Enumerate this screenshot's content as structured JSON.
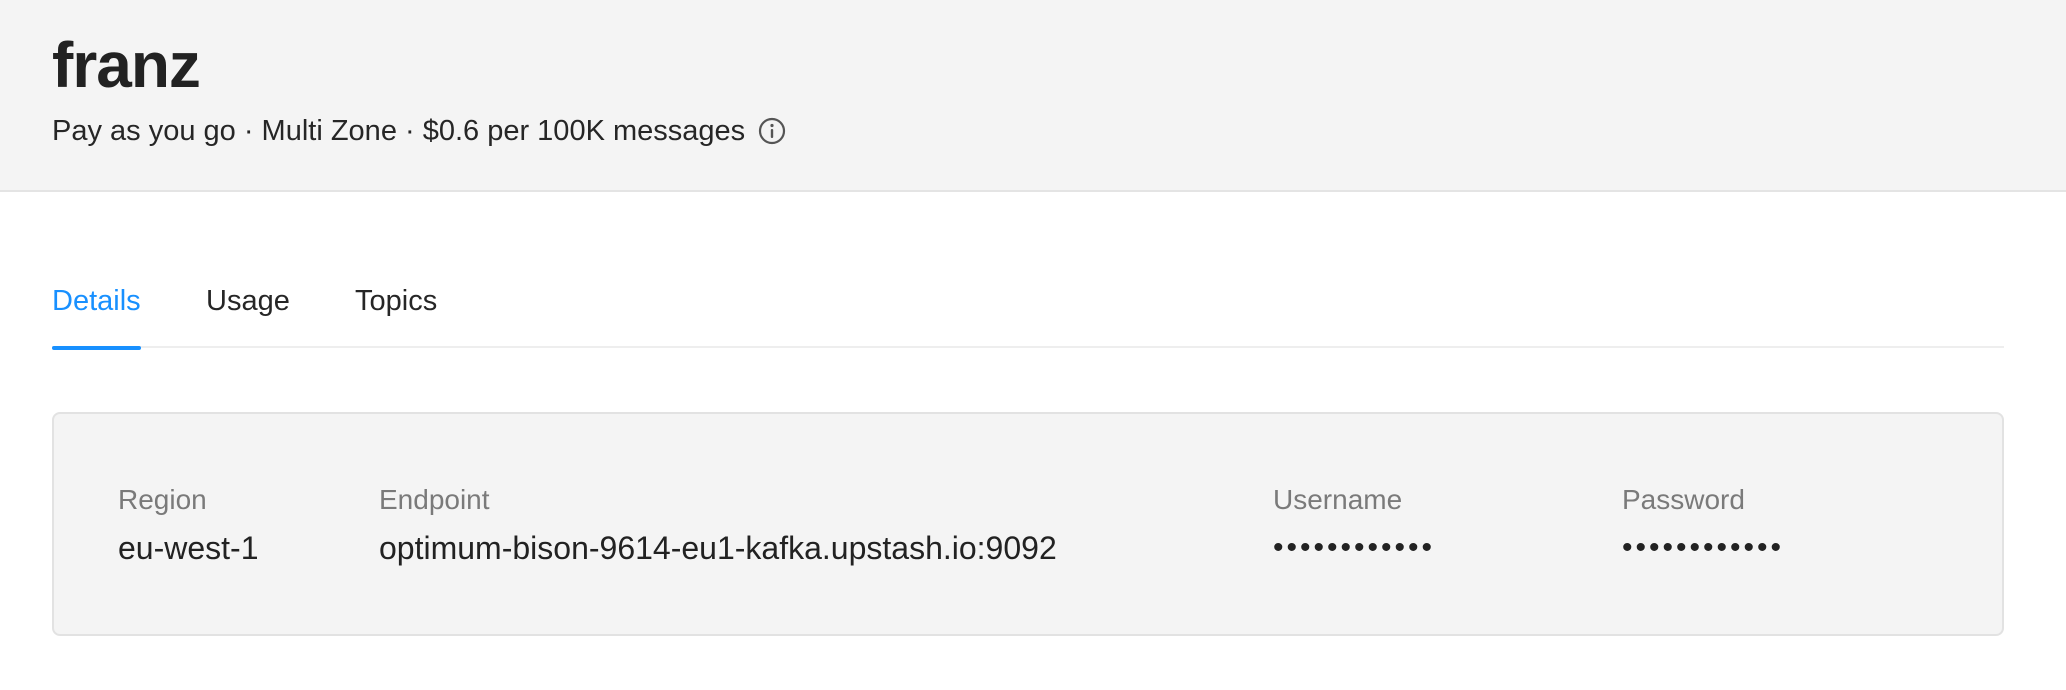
{
  "header": {
    "title": "franz",
    "subtitle": "Pay as you go · Multi Zone · $0.6 per 100K messages",
    "info_icon": "info-circle-icon"
  },
  "tabs": [
    {
      "label": "Details",
      "active": true
    },
    {
      "label": "Usage",
      "active": false
    },
    {
      "label": "Topics",
      "active": false
    }
  ],
  "details": {
    "region": {
      "label": "Region",
      "value": "eu-west-1"
    },
    "endpoint": {
      "label": "Endpoint",
      "value": "optimum-bison-9614-eu1-kafka.upstash.io:9092"
    },
    "username": {
      "label": "Username",
      "value": "••••••••••••"
    },
    "password": {
      "label": "Password",
      "value": "••••••••••••"
    }
  },
  "colors": {
    "accent": "#1890ff",
    "header_bg": "#f4f4f4",
    "card_bg": "#f4f4f4",
    "label_gray": "#7a7a7a"
  }
}
